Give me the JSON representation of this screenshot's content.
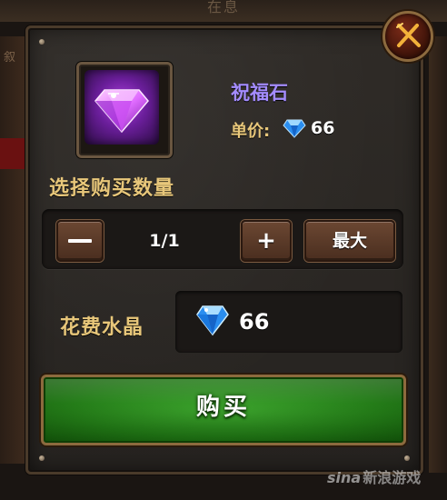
{
  "background": {
    "title": "在息",
    "side_mark": "叙"
  },
  "item": {
    "name": "祝福石",
    "icon": "purple-gem-icon"
  },
  "unit_price": {
    "label": "单价:",
    "currency_icon": "blue-crystal-icon",
    "value": "66"
  },
  "quantity": {
    "label": "选择购买数量",
    "value": "1/1",
    "minus_label": "—",
    "plus_label": "+",
    "max_label": "最大"
  },
  "cost": {
    "label": "花费水晶",
    "currency_icon": "blue-crystal-icon",
    "value": "66"
  },
  "buy_button": {
    "label": "购买"
  },
  "close_button": {
    "icon": "close-x-icon"
  },
  "watermark": {
    "brand": "sina",
    "text": "新浪游戏"
  },
  "colors": {
    "item_name": "#a48cff",
    "label_gold": "#e8c77a",
    "buy_green": "#207a14",
    "button_brown": "#5a3a28"
  }
}
